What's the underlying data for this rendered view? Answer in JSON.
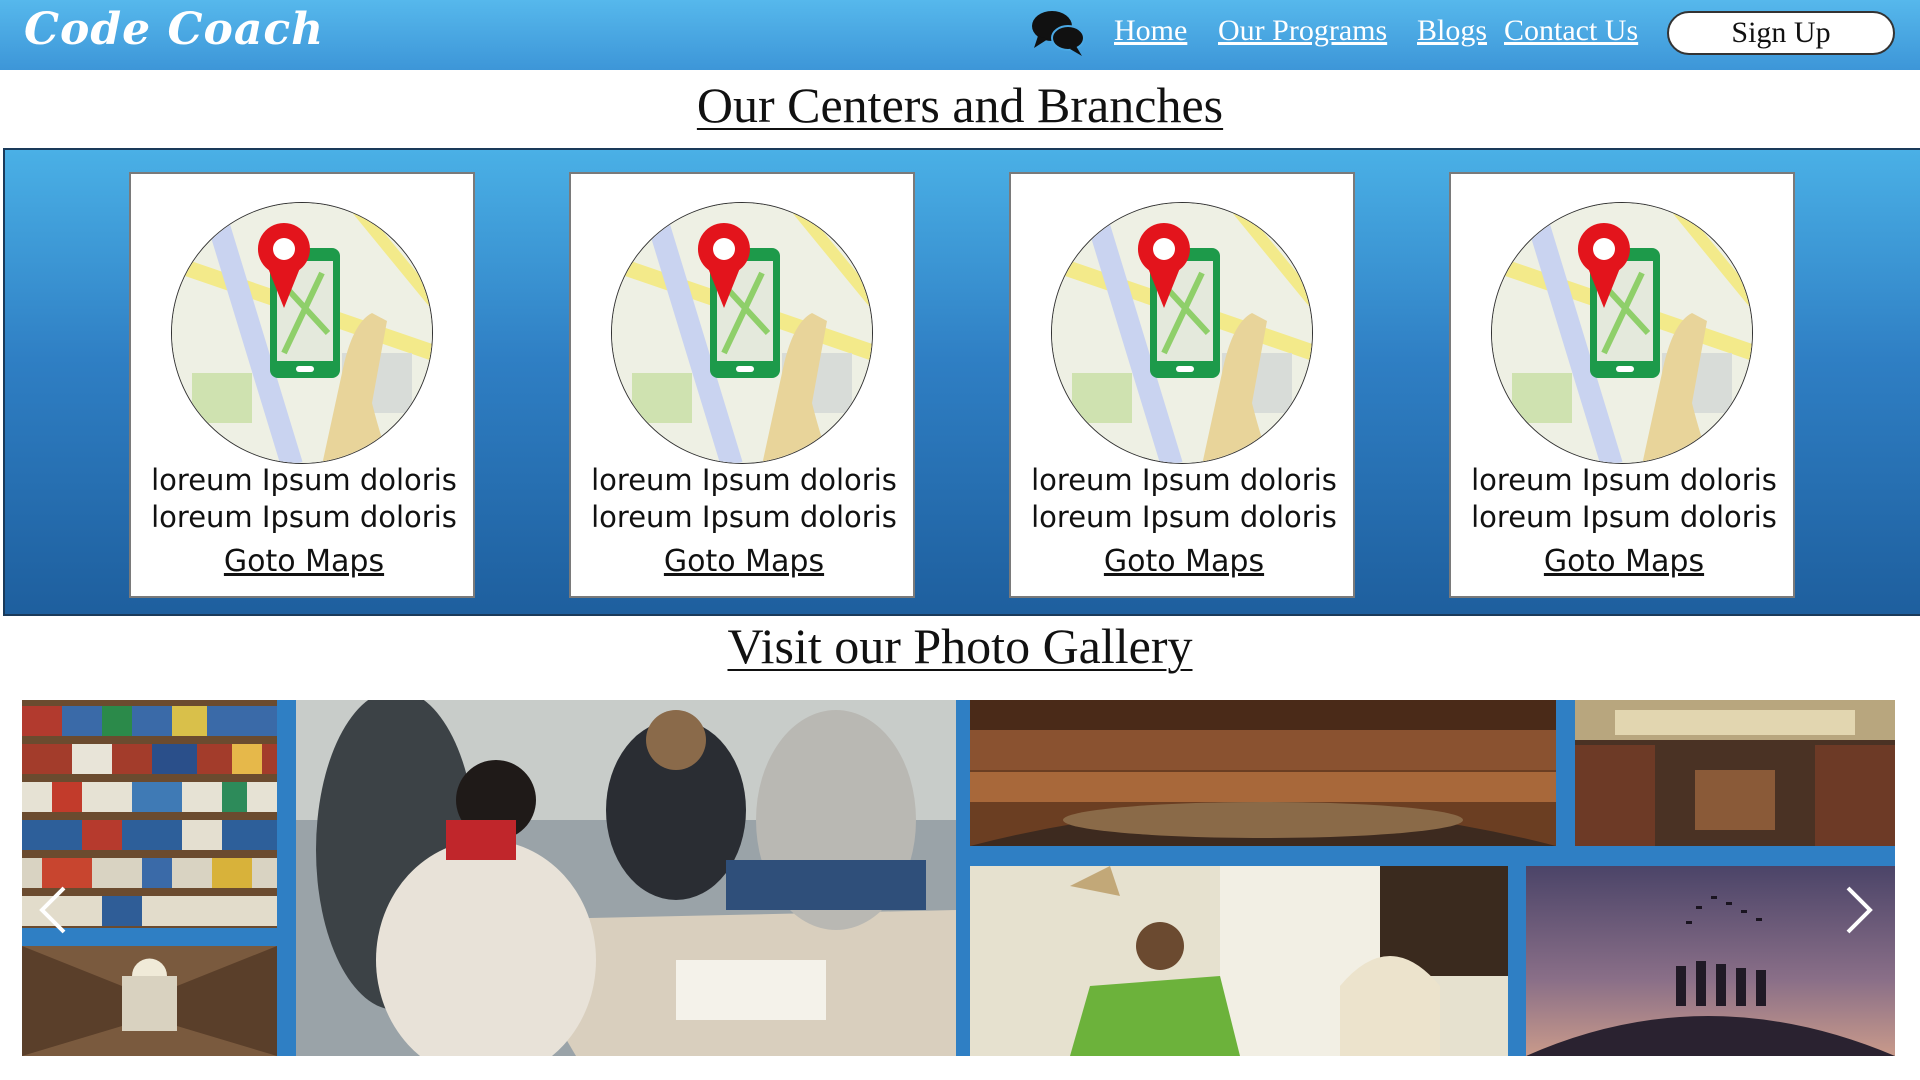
{
  "navbar": {
    "brand": "Code Coach",
    "chat_icon": "chat-bubbles-icon",
    "links": [
      {
        "label": "Home"
      },
      {
        "label": "Our Programs"
      },
      {
        "label": "Blogs"
      },
      {
        "label": "Contact Us"
      }
    ],
    "signup_label": "Sign Up"
  },
  "centers": {
    "title": "Our Centers and Branches",
    "cards": [
      {
        "line1": "loreum Ipsum doloris",
        "line2": "loreum Ipsum doloris",
        "link": "Goto Maps",
        "icon": "map-pin-phone-icon"
      },
      {
        "line1": "loreum Ipsum doloris",
        "line2": "loreum Ipsum doloris",
        "link": "Goto Maps",
        "icon": "map-pin-phone-icon"
      },
      {
        "line1": "loreum Ipsum doloris",
        "line2": "loreum Ipsum doloris",
        "link": "Goto Maps",
        "icon": "map-pin-phone-icon"
      },
      {
        "line1": "loreum Ipsum doloris",
        "line2": "loreum Ipsum doloris",
        "link": "Goto Maps",
        "icon": "map-pin-phone-icon"
      }
    ]
  },
  "gallery": {
    "title": "Visit our Photo Gallery",
    "photos": [
      "library-bookshelf",
      "library-aisle",
      "students-studying",
      "circular-library",
      "ornate-library",
      "student-with-books",
      "graduation-silhouettes"
    ],
    "prev_icon": "chevron-left-icon",
    "next_icon": "chevron-right-icon"
  },
  "colors": {
    "nav": "#4aa8e4",
    "band": "#2f7fc4",
    "pin": "#e3141c",
    "phone": "#1d9a4a"
  }
}
